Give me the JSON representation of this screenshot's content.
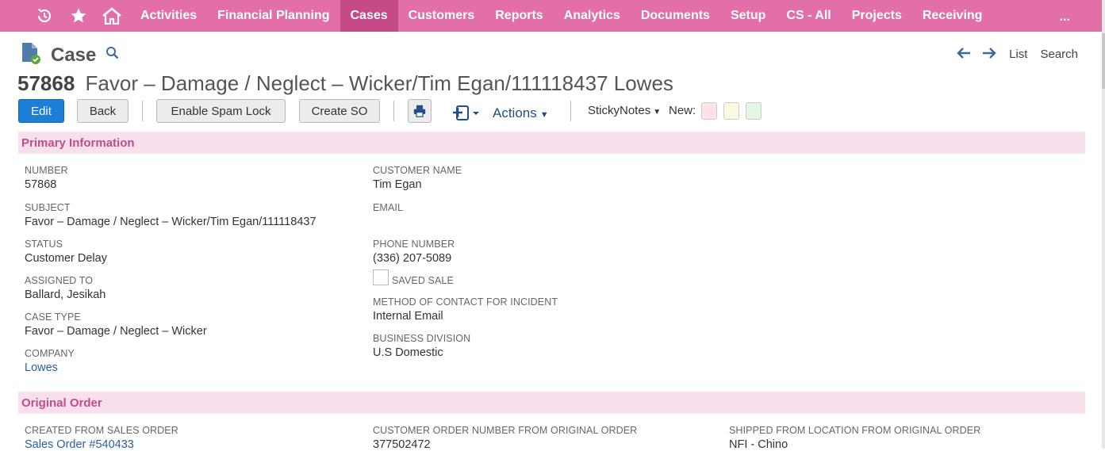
{
  "nav": {
    "items": [
      "Activities",
      "Financial Planning",
      "Cases",
      "Customers",
      "Reports",
      "Analytics",
      "Documents",
      "Setup",
      "CS - All",
      "Projects",
      "Receiving"
    ],
    "active": "Cases",
    "more": "..."
  },
  "header": {
    "record_type": "Case",
    "page_nav": {
      "list": "List",
      "search": "Search"
    }
  },
  "title": {
    "number": "57868",
    "subject": "Favor – Damage / Neglect – Wicker/Tim Egan/111118437 Lowes"
  },
  "toolbar": {
    "edit": "Edit",
    "back": "Back",
    "spam_lock": "Enable Spam Lock",
    "create_so": "Create SO",
    "actions": "Actions",
    "sticky_notes": "StickyNotes",
    "new": "New:",
    "note_colors": [
      "#fde3e6",
      "#fdf8e1",
      "#e3f8e3"
    ]
  },
  "primary": {
    "section_title": "Primary Information",
    "left": [
      {
        "label": "NUMBER",
        "value": "57868"
      },
      {
        "label": "SUBJECT",
        "value": "Favor – Damage / Neglect – Wicker/Tim Egan/111118437"
      },
      {
        "label": "STATUS",
        "value": "Customer Delay"
      },
      {
        "label": "ASSIGNED TO",
        "value": "Ballard, Jesikah"
      },
      {
        "label": "CASE TYPE",
        "value": "Favor – Damage / Neglect – Wicker"
      },
      {
        "label": "COMPANY",
        "value": "Lowes"
      }
    ],
    "right": {
      "customer_name": {
        "label": "CUSTOMER NAME",
        "value": "Tim Egan"
      },
      "email": {
        "label": "EMAIL",
        "value": ""
      },
      "phone": {
        "label": "PHONE NUMBER",
        "value": "(336) 207-5089"
      },
      "saved_sale": {
        "label": "SAVED SALE",
        "checked": false
      },
      "contact_method": {
        "label": "METHOD OF CONTACT FOR INCIDENT",
        "value": "Internal Email"
      },
      "division": {
        "label": "BUSINESS DIVISION",
        "value": "U.S Domestic"
      }
    }
  },
  "original_order": {
    "section_title": "Original Order",
    "created_from": {
      "label": "CREATED FROM SALES ORDER",
      "value": "Sales Order #540433"
    },
    "customer_order_number": {
      "label": "CUSTOMER ORDER NUMBER FROM ORIGINAL ORDER",
      "value": "377502472"
    },
    "shipped_from": {
      "label": "SHIPPED FROM LOCATION FROM ORIGINAL ORDER",
      "value": "NFI - Chino"
    }
  },
  "colors": {
    "nav_bg": "#e26fa7",
    "nav_active": "#c44a88",
    "section_bg": "#f8e1ec",
    "section_text": "#c04d86",
    "primary_button": "#1d7ed8",
    "link": "#2a5f9e"
  }
}
